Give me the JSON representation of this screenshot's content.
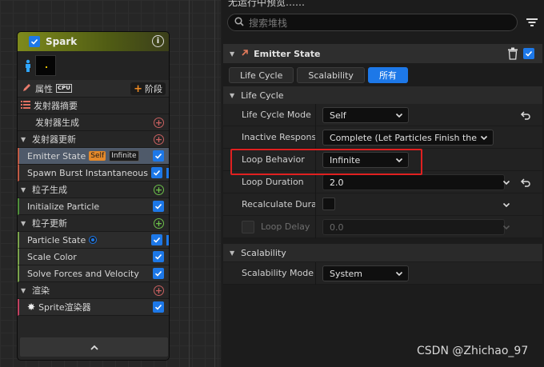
{
  "node": {
    "title": "Spark",
    "properties_label": "属性",
    "cpu_label": "CPU",
    "stage_label": "阶段",
    "items": [
      {
        "label": "发射器摘要"
      },
      {
        "label": "发射器生成"
      },
      {
        "label": "发射器更新"
      },
      {
        "label": "Emitter State",
        "tag_self": "Self",
        "tag_infinite": "Infinite"
      },
      {
        "label": "Spawn Burst Instantaneous"
      },
      {
        "label": "粒子生成"
      },
      {
        "label": "Initialize Particle"
      },
      {
        "label": "粒子更新"
      },
      {
        "label": "Particle State"
      },
      {
        "label": "Scale Color"
      },
      {
        "label": "Solve Forces and Velocity"
      },
      {
        "label": "渲染"
      },
      {
        "label": "Sprite渲染器"
      }
    ]
  },
  "panel": {
    "top_text": "无运行中预览……",
    "search_placeholder": "搜索堆栈",
    "emitter_title": "Emitter State",
    "tabs": [
      {
        "label": "Life Cycle"
      },
      {
        "label": "Scalability"
      },
      {
        "label": "所有"
      }
    ],
    "categories": {
      "life_cycle": "Life Cycle",
      "scalability": "Scalability"
    },
    "properties": {
      "life_cycle_mode": {
        "label": "Life Cycle Mode",
        "value": "Self"
      },
      "inactive_response": {
        "label": "Inactive Respons",
        "value": "Complete (Let Particles Finish ther"
      },
      "loop_behavior": {
        "label": "Loop Behavior",
        "value": "Infinite"
      },
      "loop_duration": {
        "label": "Loop Duration",
        "value": "2.0"
      },
      "recalculate_duration": {
        "label": "Recalculate Durat"
      },
      "loop_delay": {
        "label": "Loop Delay",
        "value": "0.0"
      },
      "scalability_mode": {
        "label": "Scalability Mode",
        "value": "System"
      }
    }
  },
  "watermark": "CSDN @Zhichao_97",
  "colors": {
    "accent": "#1d78e8",
    "highlight_box": "#e02020",
    "node_header": "#7e8a1c"
  }
}
